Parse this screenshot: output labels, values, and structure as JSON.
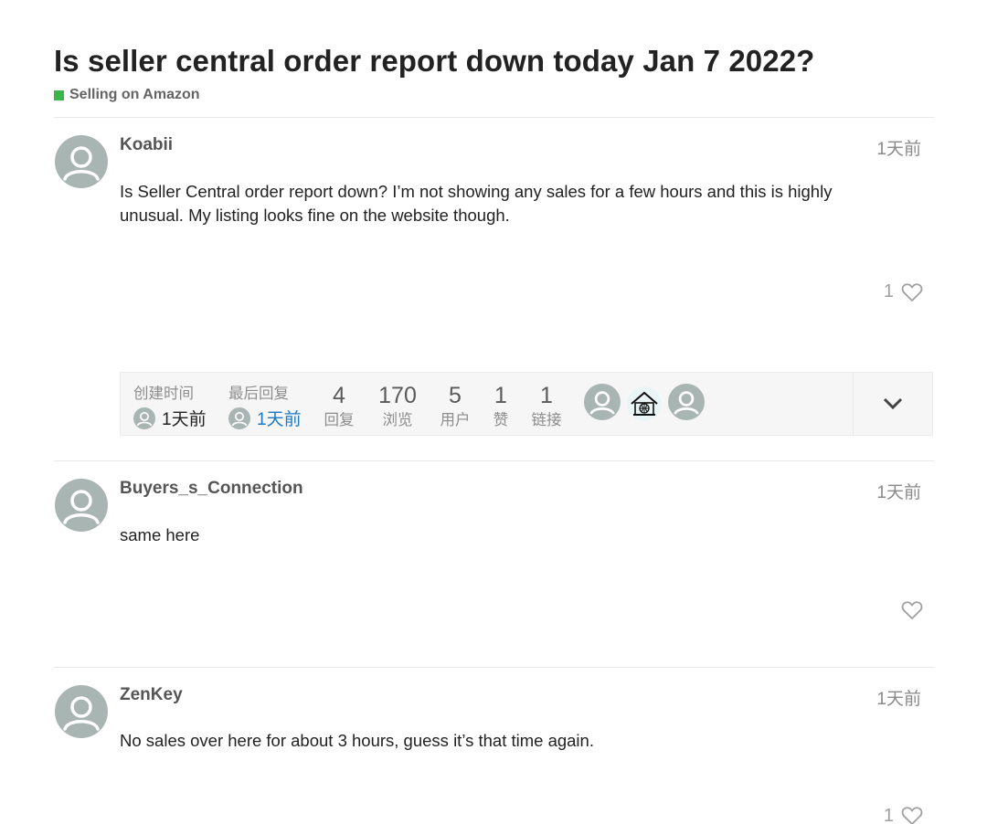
{
  "topic": {
    "title": "Is seller central order report down today Jan 7 2022?",
    "category": "Selling on Amazon",
    "category_color": "#3ab54a"
  },
  "posts": [
    {
      "username": "Koabii",
      "date": "1天前",
      "body": "Is Seller Central order report down? I’m not showing any sales for a few hours and this is highly unusual. My listing looks fine on the website though.",
      "likes": "1",
      "icon": "heart-icon"
    },
    {
      "username": "Buyers_s_Connection",
      "date": "1天前",
      "body": "same here",
      "likes": "",
      "icon": "heart-icon"
    },
    {
      "username": "ZenKey",
      "date": "1天前",
      "body": "No sales over here for about 3 hours, guess it’s that time again.",
      "likes": "1",
      "icon": "heart-icon"
    }
  ],
  "topic_map": {
    "created_label": "创建时间",
    "created_value": "1天前",
    "last_reply_label": "最后回复",
    "last_reply_value": "1天前",
    "replies_num": "4",
    "replies_label": "回复",
    "views_num": "170",
    "views_label": "浏览",
    "users_num": "5",
    "users_label": "用户",
    "likes_num": "1",
    "likes_label": "赞",
    "links_num": "1",
    "links_label": "链接",
    "expand_icon": "chevron-down-icon"
  },
  "colors": {
    "link_blue": "#1b79c4",
    "avatar_gray": "#a9b5b3",
    "muted": "#8a8a8a"
  }
}
